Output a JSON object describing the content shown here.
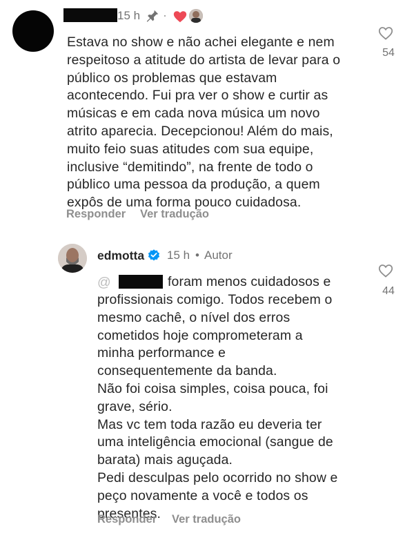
{
  "colors": {
    "like_heart_badge": "#ed4956",
    "verified": "#0095f6",
    "muted_text": "#737373",
    "action_text": "#8e8e8e"
  },
  "comment1": {
    "time": "15 h",
    "pin_icon": "pin-icon",
    "text": "Estava no show e não achei elegante e nem\nrespeitoso a atitude do artista de levar para o\npúblico os problemas que estavam\nacontecendo. Fui pra ver o show e curtir as\nmúsicas e em cada nova música um novo\natrito aparecia. Decepcionou! Além do mais,\nmuito feio suas atitudes com sua equipe,\ninclusive “demitindo”, na frente de todo o\npúblico uma pessoa da produção, a quem\nexpôs de uma forma pouco cuidadosa.",
    "likes": "54",
    "reply_label": "Responder",
    "translate_label": "Ver tradução"
  },
  "comment2": {
    "username": "edmotta",
    "time": "15 h",
    "dot": "•",
    "author_label": "Autor",
    "mention_prefix": "@",
    "text_first_line": "foram menos cuidadosos e",
    "text": "profissionais comigo. Todos recebem o\nmesmo cachê, o nível dos erros\ncometidos hoje comprometeram a\nminha performance e\nconsequentemente da banda.\nNão foi coisa simples, coisa pouca, foi\ngrave, sério.\nMas vc tem toda razão eu deveria ter\numa inteligência emocional (sangue de\nbarata) mais aguçada.\nPedi desculpas pelo ocorrido no show e\npeço novamente a você e todos os\npresentes.",
    "likes": "44",
    "reply_label": "Responder",
    "translate_label": "Ver tradução"
  }
}
